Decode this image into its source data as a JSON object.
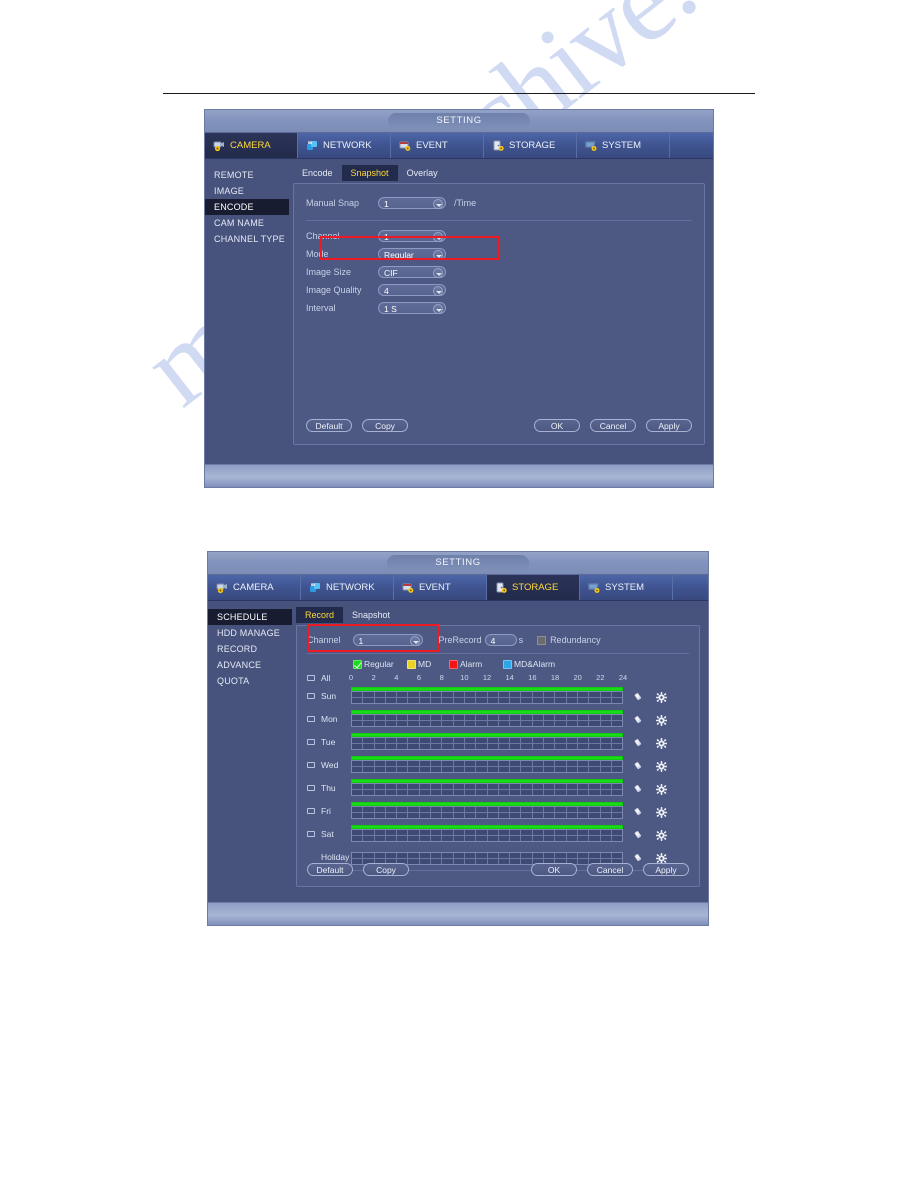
{
  "watermark": "manualarchive.com",
  "colors": {
    "accent_yellow": "#ffd83a",
    "highlight_red": "#ee1b24",
    "regular_green": "#17dd17",
    "md_yellow": "#e8d429",
    "alarm_red": "#f21515",
    "mdalarm_blue": "#2ba7e8",
    "dialog_bg": "#47537d",
    "panel_bg": "#4d5982"
  },
  "dialog1": {
    "title": "SETTING",
    "tabs": [
      {
        "label": "CAMERA",
        "icon": "camera-gear-icon",
        "active": true
      },
      {
        "label": "NETWORK",
        "icon": "network-icon",
        "active": false
      },
      {
        "label": "EVENT",
        "icon": "event-gear-icon",
        "active": false
      },
      {
        "label": "STORAGE",
        "icon": "storage-gear-icon",
        "active": false
      },
      {
        "label": "SYSTEM",
        "icon": "system-gear-icon",
        "active": false
      }
    ],
    "sidebar": [
      {
        "label": "REMOTE",
        "active": false
      },
      {
        "label": "IMAGE",
        "active": false
      },
      {
        "label": "ENCODE",
        "active": true
      },
      {
        "label": "CAM NAME",
        "active": false
      },
      {
        "label": "CHANNEL TYPE",
        "active": false
      }
    ],
    "subtabs": [
      {
        "label": "Encode",
        "active": false
      },
      {
        "label": "Snapshot",
        "active": true
      },
      {
        "label": "Overlay",
        "active": false
      }
    ],
    "fields": {
      "manual_snap_label": "Manual Snap",
      "manual_snap_value": "1",
      "manual_snap_suffix": "/Time",
      "channel_label": "Channel",
      "channel_value": "1",
      "mode_label": "Mode",
      "mode_value": "Regular",
      "image_size_label": "Image Size",
      "image_size_value": "CIF",
      "image_quality_label": "Image Quality",
      "image_quality_value": "4",
      "interval_label": "Interval",
      "interval_value": "1 S"
    },
    "buttons": {
      "default": "Default",
      "copy": "Copy",
      "ok": "OK",
      "cancel": "Cancel",
      "apply": "Apply"
    }
  },
  "dialog2": {
    "title": "SETTING",
    "tabs": [
      {
        "label": "CAMERA",
        "icon": "camera-gear-icon",
        "active": false
      },
      {
        "label": "NETWORK",
        "icon": "network-icon",
        "active": false
      },
      {
        "label": "EVENT",
        "icon": "event-gear-icon",
        "active": false
      },
      {
        "label": "STORAGE",
        "icon": "storage-gear-icon",
        "active": true
      },
      {
        "label": "SYSTEM",
        "icon": "system-gear-icon",
        "active": false
      }
    ],
    "sidebar": [
      {
        "label": "SCHEDULE",
        "active": true
      },
      {
        "label": "HDD MANAGE",
        "active": false
      },
      {
        "label": "RECORD",
        "active": false
      },
      {
        "label": "ADVANCE",
        "active": false
      },
      {
        "label": "QUOTA",
        "active": false
      }
    ],
    "subtabs": [
      {
        "label": "Record",
        "active": true
      },
      {
        "label": "Snapshot",
        "active": false
      }
    ],
    "fields": {
      "channel_label": "Channel",
      "channel_value": "1",
      "prerecord_label": "PreRecord",
      "prerecord_value": "4",
      "prerecord_suffix": "s",
      "redundancy_label": "Redundancy",
      "redundancy_checked": false
    },
    "legend": [
      {
        "label": "Regular",
        "color": "#17dd17",
        "checked": true
      },
      {
        "label": "MD",
        "color": "#e8d429",
        "checked": false
      },
      {
        "label": "Alarm",
        "color": "#f21515",
        "checked": false
      },
      {
        "label": "MD&Alarm",
        "color": "#2ba7e8",
        "checked": false
      }
    ],
    "all_label": "All",
    "hour_ticks": [
      "0",
      "2",
      "4",
      "6",
      "8",
      "10",
      "12",
      "14",
      "16",
      "18",
      "20",
      "22",
      "24"
    ],
    "rows": [
      {
        "label": "Sun",
        "has_checkbox": true,
        "green_start_pct": 0,
        "green_width_pct": 100
      },
      {
        "label": "Mon",
        "has_checkbox": true,
        "green_start_pct": 0,
        "green_width_pct": 100
      },
      {
        "label": "Tue",
        "has_checkbox": true,
        "green_start_pct": 0,
        "green_width_pct": 100
      },
      {
        "label": "Wed",
        "has_checkbox": true,
        "green_start_pct": 0,
        "green_width_pct": 100
      },
      {
        "label": "Thu",
        "has_checkbox": true,
        "green_start_pct": 0,
        "green_width_pct": 100
      },
      {
        "label": "Fri",
        "has_checkbox": true,
        "green_start_pct": 0,
        "green_width_pct": 100
      },
      {
        "label": "Sat",
        "has_checkbox": true,
        "green_start_pct": 0,
        "green_width_pct": 100
      },
      {
        "label": "Holiday",
        "has_checkbox": false,
        "green_start_pct": 0,
        "green_width_pct": 0
      }
    ],
    "row_icons": [
      {
        "name": "eraser-icon"
      },
      {
        "name": "gear-icon"
      }
    ],
    "buttons": {
      "default": "Default",
      "copy": "Copy",
      "ok": "OK",
      "cancel": "Cancel",
      "apply": "Apply"
    }
  }
}
